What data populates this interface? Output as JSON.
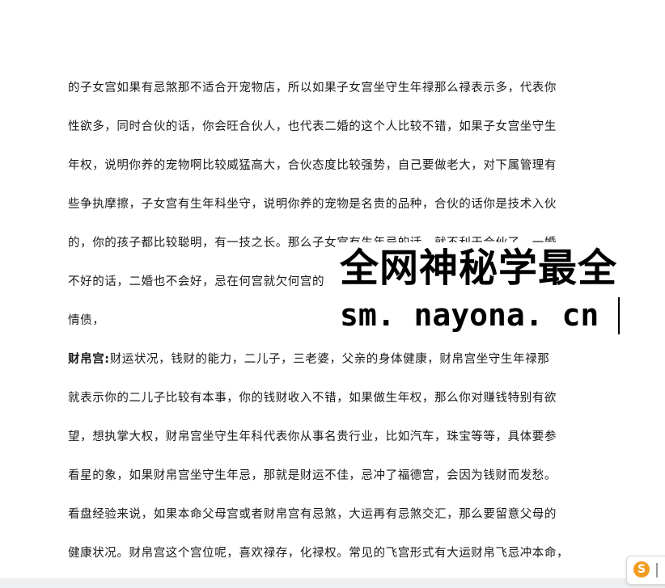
{
  "document": {
    "lines": [
      {
        "text": "的子女宫如果有忌煞那不适合开宠物店，所以如果子女宫坐守生年禄那么禄表示多，代表你"
      },
      {
        "text": "性欲多，同时合伙的话，你会旺合伙人，也代表二婚的这个人比较不错，如果子女宫坐守生"
      },
      {
        "text": "年权，说明你养的宠物啊比较威猛高大，合伙态度比较强势，自己要做老大，对下属管理有"
      },
      {
        "text": "些争执摩擦，子女宫有生年科坐守，说明你养的宠物是名贵的品种，合伙的话你是技术入伙"
      },
      {
        "text": "的，你的孩子都比较聪明，有一技之长。那么子女宫有生年忌的话，就不利于合伙了，一婚"
      },
      {
        "text": "不好的话，二婚也不会好，忌在何宫就欠何宫的"
      },
      {
        "text": "情债，"
      },
      {
        "heading": "财帛宫:",
        "text": "财运状况，钱财的能力，二儿子，三老婆，父亲的身体健康，财帛宫坐守生年禄那"
      },
      {
        "text": "就表示你的二儿子比较有本事，你的钱财收入不错，如果做生年权，那么你对赚钱特别有欲"
      },
      {
        "text": "望，想执掌大权，财帛宫坐守生年科代表你从事名贵行业，比如汽车，珠宝等等，具体要参"
      },
      {
        "text": "看星的象，如果财帛宫坐守生年忌，那就是财运不佳，忌冲了福德宫，会因为钱财而发愁。"
      },
      {
        "text": "看盘经验来说，如果本命父母宫或者财帛宫有忌煞，大运再有忌煞交汇，那么要留意父母的"
      },
      {
        "text": "健康状况。财帛宫这个宫位呢，喜欢禄存，化禄权。常见的飞宫形式有大运财帛飞忌冲本命，"
      }
    ]
  },
  "watermark": {
    "title": "全网神秘学最全",
    "url": "sm. nayona. cn"
  },
  "ime": {
    "icon_name": "sogou-ime-icon",
    "icon_glyph": "S",
    "accent_color": "#f29c1f"
  }
}
